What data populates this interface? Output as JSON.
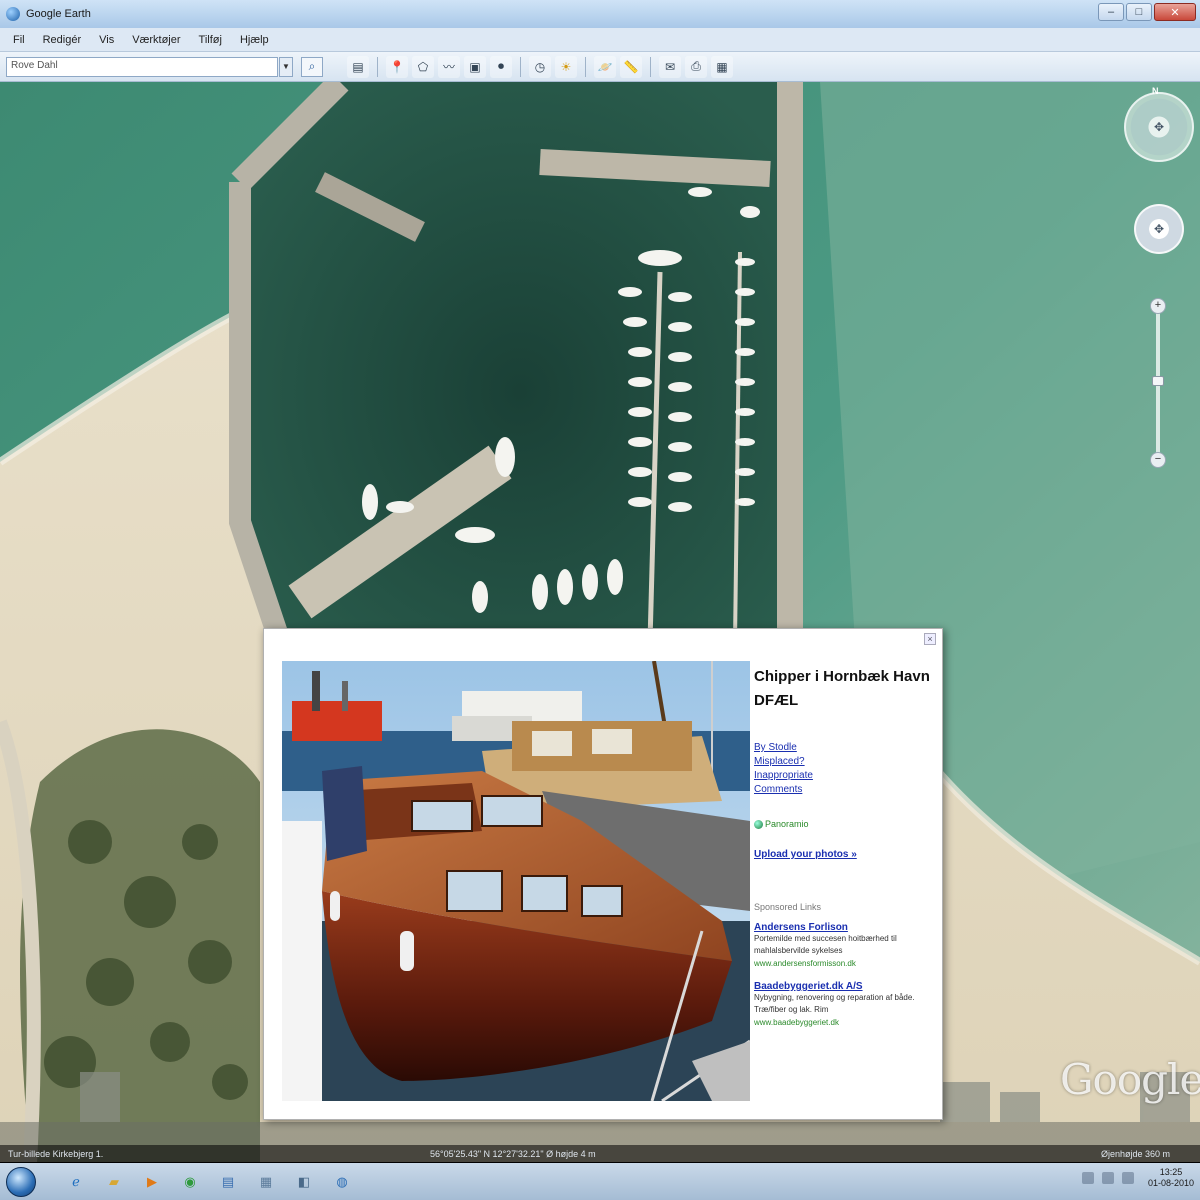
{
  "window": {
    "title": "Google Earth",
    "controls": {
      "minimize": "–",
      "maximize": "□",
      "close": "✕"
    }
  },
  "menubar": {
    "items": [
      "Fil",
      "Redigér",
      "Vis",
      "Værktøjer",
      "Tilføj",
      "Hjælp"
    ]
  },
  "toolbar": {
    "search_value": "Rove Dahl",
    "icons": [
      "sidebar-icon",
      "placemark-icon",
      "polygon-icon",
      "path-icon",
      "overlay-icon",
      "record-tour-icon",
      "history-icon",
      "sun-icon",
      "planets-icon",
      "ruler-icon",
      "email-icon",
      "print-icon",
      "maps-icon"
    ]
  },
  "balloon": {
    "title": "Chipper i Hornbæk Havn DFÆL",
    "links": [
      "By Stodle",
      "Misplaced?",
      "Inappropriate",
      "Comments"
    ],
    "powered_by": "Panoramio",
    "upload": "Upload your photos »",
    "sponsored_heading": "Sponsored Links",
    "ads": [
      {
        "title": "Andersens Forlison",
        "text": "Portemilde med succesen hoitbærhed til mahlalsbervilde sykelses",
        "url": "www.andersensformisson.dk"
      },
      {
        "title": "Baadebyggeriet.dk A/S",
        "text": "Nybygning, renovering og reparation af både. Træ/fiber og lak. Rim",
        "url": "www.baadebyggeriet.dk"
      }
    ]
  },
  "statusbar": {
    "left": "Tur-billede   Kirkebjerg 1.",
    "center": "56°05'25.43\" N   12°27'32.21\" Ø   højde 4 m",
    "right": "Øjenhøjde   360 m"
  },
  "logo": "Google",
  "taskbar": {
    "clock_time": "13:25",
    "clock_date": "01-08-2010"
  },
  "colors": {
    "sea": "#3f8f78",
    "harbor_water": "#1f4a40",
    "sand": "#e6dcc4",
    "link": "#1a2fb0"
  }
}
